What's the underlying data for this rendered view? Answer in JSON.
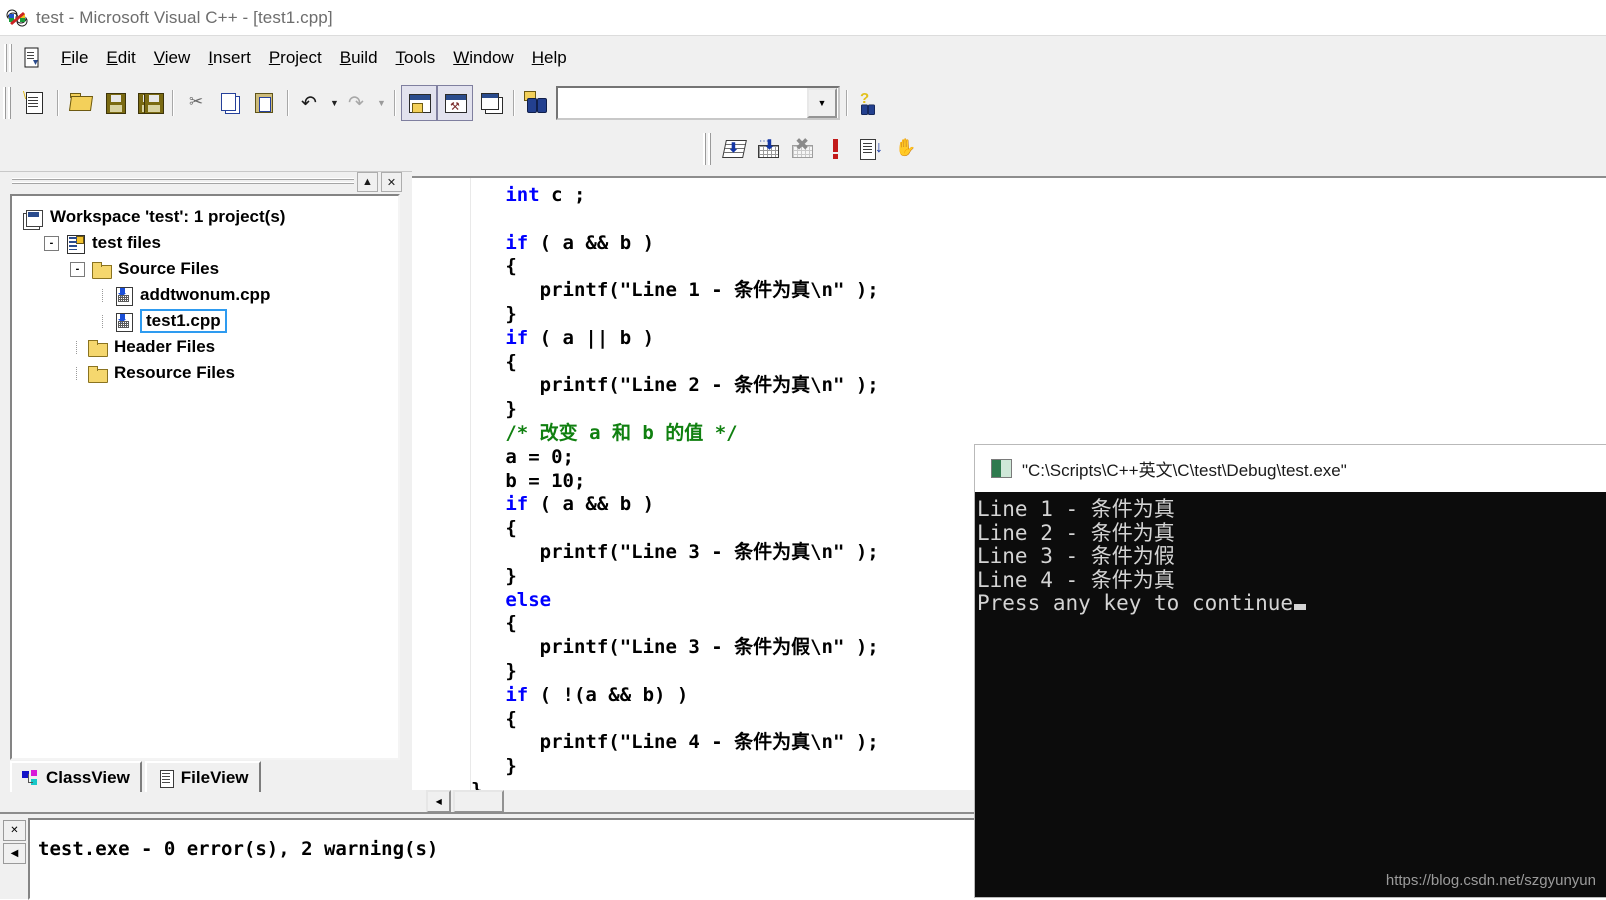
{
  "window": {
    "title": "test - Microsoft Visual C++ - [test1.cpp]",
    "app_icon": "vcpp-logo-icon"
  },
  "menu": {
    "doc_icon": "document-properties-icon",
    "items": [
      {
        "label": "File",
        "accel": "F"
      },
      {
        "label": "Edit",
        "accel": "E"
      },
      {
        "label": "View",
        "accel": "V"
      },
      {
        "label": "Insert",
        "accel": "I"
      },
      {
        "label": "Project",
        "accel": "P"
      },
      {
        "label": "Build",
        "accel": "B"
      },
      {
        "label": "Tools",
        "accel": "T"
      },
      {
        "label": "Window",
        "accel": "W"
      },
      {
        "label": "Help",
        "accel": "H"
      }
    ]
  },
  "toolbar_standard": {
    "buttons": [
      {
        "name": "new-text-file-icon",
        "title": "New Text File"
      },
      {
        "name": "open-icon",
        "title": "Open"
      },
      {
        "name": "save-icon",
        "title": "Save"
      },
      {
        "name": "save-all-icon",
        "title": "Save All"
      },
      {
        "name": "cut-icon",
        "title": "Cut"
      },
      {
        "name": "copy-icon",
        "title": "Copy"
      },
      {
        "name": "paste-icon",
        "title": "Paste"
      },
      {
        "name": "undo-icon",
        "title": "Undo"
      },
      {
        "name": "redo-icon",
        "title": "Redo"
      },
      {
        "name": "workspace-toggle-icon",
        "title": "Workspace"
      },
      {
        "name": "output-toggle-icon",
        "title": "Output"
      },
      {
        "name": "window-list-icon",
        "title": "Windows"
      },
      {
        "name": "find-in-files-icon",
        "title": "Find in Files"
      },
      {
        "name": "search-help-icon",
        "title": "Search"
      }
    ],
    "search_combo": {
      "value": "",
      "placeholder": "",
      "dropdown_icon": "chevron-down-icon"
    }
  },
  "toolbar_build": {
    "buttons": [
      {
        "name": "compile-icon",
        "title": "Compile"
      },
      {
        "name": "build-icon",
        "title": "Build"
      },
      {
        "name": "rebuild-all-icon",
        "title": "Rebuild All",
        "disabled": true
      },
      {
        "name": "stop-build-icon",
        "title": "Stop Build"
      },
      {
        "name": "execute-program-icon",
        "title": "Execute Program"
      },
      {
        "name": "go-debug-icon",
        "title": "Go"
      }
    ]
  },
  "workspace": {
    "panel_buttons": [
      {
        "name": "minimize-panel-button",
        "glyph": "▲"
      },
      {
        "name": "close-panel-button",
        "glyph": "✕"
      }
    ],
    "tree": [
      {
        "label": "Workspace 'test': 1 project(s)",
        "icon": "workspace-icon",
        "depth": 0,
        "expander": "",
        "selected": false
      },
      {
        "label": "test files",
        "icon": "project-icon",
        "depth": 1,
        "expander": "-",
        "selected": false
      },
      {
        "label": "Source Files",
        "icon": "folder-icon",
        "depth": 2,
        "expander": "-",
        "selected": false
      },
      {
        "label": "addtwonum.cpp",
        "icon": "cpp-file-icon",
        "depth": 3,
        "expander": "",
        "selected": false
      },
      {
        "label": "test1.cpp",
        "icon": "cpp-file-icon",
        "depth": 3,
        "expander": "",
        "selected": true
      },
      {
        "label": "Header Files",
        "icon": "folder-icon",
        "depth": 2,
        "expander": "",
        "selected": false
      },
      {
        "label": "Resource Files",
        "icon": "folder-icon",
        "depth": 2,
        "expander": "",
        "selected": false
      }
    ],
    "tabs": [
      {
        "label": "ClassView",
        "icon": "class-view-icon",
        "active": false
      },
      {
        "label": "FileView",
        "icon": "file-view-icon",
        "active": true
      }
    ]
  },
  "editor": {
    "filename": "test1.cpp",
    "scrollbar": {
      "left_arrow": "◀",
      "name": "horizontal-scrollbar"
    },
    "lines": [
      [
        {
          "t": "   ",
          "c": ""
        },
        {
          "t": "int",
          "c": "kw"
        },
        {
          "t": " c ;",
          "c": ""
        }
      ],
      [
        {
          "t": "",
          "c": ""
        }
      ],
      [
        {
          "t": "   ",
          "c": ""
        },
        {
          "t": "if",
          "c": "kw"
        },
        {
          "t": " ( a && b )",
          "c": ""
        }
      ],
      [
        {
          "t": "   {",
          "c": ""
        }
      ],
      [
        {
          "t": "      printf(\"Line 1 - 条件为真\\n\" );",
          "c": ""
        }
      ],
      [
        {
          "t": "   }",
          "c": ""
        }
      ],
      [
        {
          "t": "   ",
          "c": ""
        },
        {
          "t": "if",
          "c": "kw"
        },
        {
          "t": " ( a || b )",
          "c": ""
        }
      ],
      [
        {
          "t": "   {",
          "c": ""
        }
      ],
      [
        {
          "t": "      printf(\"Line 2 - 条件为真\\n\" );",
          "c": ""
        }
      ],
      [
        {
          "t": "   }",
          "c": ""
        }
      ],
      [
        {
          "t": "   ",
          "c": ""
        },
        {
          "t": "/* 改变 a 和 b 的值 */",
          "c": "cm"
        }
      ],
      [
        {
          "t": "   a = 0;",
          "c": ""
        }
      ],
      [
        {
          "t": "   b = 10;",
          "c": ""
        }
      ],
      [
        {
          "t": "   ",
          "c": ""
        },
        {
          "t": "if",
          "c": "kw"
        },
        {
          "t": " ( a && b )",
          "c": ""
        }
      ],
      [
        {
          "t": "   {",
          "c": ""
        }
      ],
      [
        {
          "t": "      printf(\"Line 3 - 条件为真\\n\" );",
          "c": ""
        }
      ],
      [
        {
          "t": "   }",
          "c": ""
        }
      ],
      [
        {
          "t": "   ",
          "c": ""
        },
        {
          "t": "else",
          "c": "kw"
        }
      ],
      [
        {
          "t": "   {",
          "c": ""
        }
      ],
      [
        {
          "t": "      printf(\"Line 3 - 条件为假\\n\" );",
          "c": ""
        }
      ],
      [
        {
          "t": "   }",
          "c": ""
        }
      ],
      [
        {
          "t": "   ",
          "c": ""
        },
        {
          "t": "if",
          "c": "kw"
        },
        {
          "t": " ( !(a && b) )",
          "c": ""
        }
      ],
      [
        {
          "t": "   {",
          "c": ""
        }
      ],
      [
        {
          "t": "      printf(\"Line 4 - 条件为真\\n\" );",
          "c": ""
        }
      ],
      [
        {
          "t": "   }",
          "c": ""
        }
      ],
      [
        {
          "t": "}",
          "c": ""
        }
      ]
    ]
  },
  "output_pane": {
    "buttons": [
      {
        "name": "close-output-button",
        "glyph": "✕"
      },
      {
        "name": "scroll-left-button",
        "glyph": "◀"
      }
    ],
    "text": "test.exe - 0 error(s), 2 warning(s)"
  },
  "console": {
    "icon": "console-window-icon",
    "title": "\"C:\\Scripts\\C++英文\\C\\test\\Debug\\test.exe\"",
    "lines": [
      "Line 1 - 条件为真",
      "Line 2 - 条件为真",
      "Line 3 - 条件为假",
      "Line 4 - 条件为真"
    ],
    "prompt": "Press any key to continue"
  },
  "watermark": "https://blog.csdn.net/szgyunyun",
  "colors": {
    "keyword": "#0000ff",
    "comment": "#108010",
    "console_bg": "#0c0c0c",
    "console_fg": "#d4d4d4",
    "chrome": "#f0f0f0",
    "selection_border": "#2e9bf0"
  }
}
